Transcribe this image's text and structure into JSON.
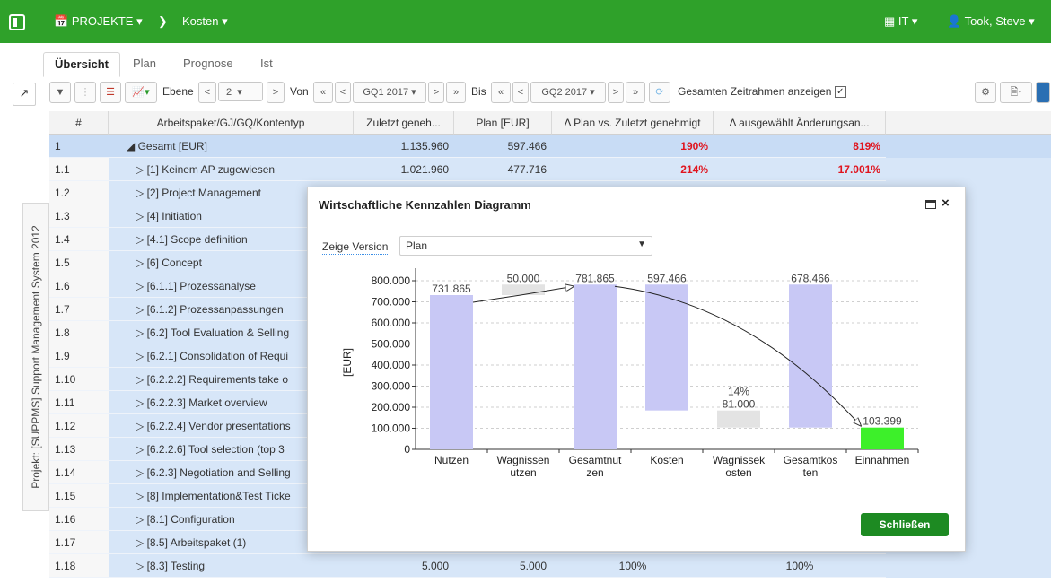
{
  "header": {
    "logo_icon": "panel-icon",
    "projects_label": "PROJEKTE",
    "breadcrumb_item": "Kosten",
    "lang_label": "IT",
    "user_label": "Took, Steve"
  },
  "tabs": [
    "Übersicht",
    "Plan",
    "Prognose",
    "Ist"
  ],
  "toolbar": {
    "ebene_label": "Ebene",
    "ebene_value": "2",
    "von_label": "Von",
    "von_value": "GQ1 2017",
    "bis_label": "Bis",
    "bis_value": "GQ2 2017",
    "full_range_label": "Gesamten Zeitrahmen anzeigen"
  },
  "side_tab": "Projekt: [SUPPMS] Support Management System 2012",
  "table": {
    "headers": [
      "#",
      "Arbeitspaket/GJ/GQ/Kontentyp",
      "Zuletzt geneh...",
      "Plan [EUR]",
      "Δ Plan vs. Zuletzt genehmigt",
      "Δ ausgewählt Änderungsan..."
    ],
    "rows": [
      {
        "num": "1",
        "name": "◢ Gesamt [EUR]",
        "approved": "1.135.960",
        "plan": "597.466",
        "delta": "190%",
        "delta2": "819%"
      },
      {
        "num": "1.1",
        "name": "▷ [1] Keinem AP zugewiesen",
        "approved": "1.021.960",
        "plan": "477.716",
        "delta": "214%",
        "delta2": "17.001%"
      },
      {
        "num": "1.2",
        "name": "▷ [2] Project Management",
        "approved": "",
        "plan": "",
        "delta": "",
        "delta2": ""
      },
      {
        "num": "1.3",
        "name": "▷ [4] Initiation",
        "approved": "",
        "plan": "",
        "delta": "",
        "delta2": ""
      },
      {
        "num": "1.4",
        "name": "▷ [4.1] Scope definition",
        "approved": "",
        "plan": "",
        "delta": "",
        "delta2": ""
      },
      {
        "num": "1.5",
        "name": "▷ [6] Concept",
        "approved": "",
        "plan": "",
        "delta": "",
        "delta2": ""
      },
      {
        "num": "1.6",
        "name": "▷ [6.1.1] Prozessanalyse",
        "approved": "",
        "plan": "",
        "delta": "",
        "delta2": ""
      },
      {
        "num": "1.7",
        "name": "▷ [6.1.2] Prozessanpassungen",
        "approved": "",
        "plan": "",
        "delta": "",
        "delta2": ""
      },
      {
        "num": "1.8",
        "name": "▷ [6.2] Tool Evaluation & Selling",
        "approved": "",
        "plan": "",
        "delta": "",
        "delta2": ""
      },
      {
        "num": "1.9",
        "name": "▷ [6.2.1] Consolidation of Requi",
        "approved": "",
        "plan": "",
        "delta": "",
        "delta2": ""
      },
      {
        "num": "1.10",
        "name": "▷ [6.2.2.2] Requirements take o",
        "approved": "",
        "plan": "",
        "delta": "",
        "delta2": ""
      },
      {
        "num": "1.11",
        "name": "▷ [6.2.2.3] Market overview",
        "approved": "",
        "plan": "",
        "delta": "",
        "delta2": ""
      },
      {
        "num": "1.12",
        "name": "▷ [6.2.2.4] Vendor presentations",
        "approved": "",
        "plan": "",
        "delta": "",
        "delta2": ""
      },
      {
        "num": "1.13",
        "name": "▷ [6.2.2.6] Tool selection (top 3",
        "approved": "",
        "plan": "",
        "delta": "",
        "delta2": ""
      },
      {
        "num": "1.14",
        "name": "▷ [6.2.3] Negotiation and Selling",
        "approved": "",
        "plan": "",
        "delta": "",
        "delta2": ""
      },
      {
        "num": "1.15",
        "name": "▷ [8] Implementation&Test Ticke",
        "approved": "",
        "plan": "",
        "delta": "",
        "delta2": ""
      },
      {
        "num": "1.16",
        "name": "▷ [8.1] Configuration",
        "approved": "",
        "plan": "",
        "delta": "",
        "delta2": ""
      },
      {
        "num": "1.17",
        "name": "▷ [8.5] Arbeitspaket (1)",
        "approved": "",
        "plan": "",
        "delta": "",
        "delta2": ""
      },
      {
        "num": "1.18",
        "name": "▷ [8.3] Testing",
        "approved": "5.000",
        "plan": "5.000",
        "delta": "100%",
        "delta2": "100%"
      }
    ]
  },
  "modal": {
    "title": "Wirtschaftliche Kennzahlen Diagramm",
    "version_label": "Zeige Version",
    "version_value": "Plan",
    "close_button": "Schließen"
  },
  "chart_data": {
    "type": "bar",
    "ylabel": "[EUR]",
    "ylim": [
      0,
      800000
    ],
    "y_ticks": [
      "0",
      "100.000",
      "200.000",
      "300.000",
      "400.000",
      "500.000",
      "600.000",
      "700.000",
      "800.000"
    ],
    "y_tick_values": [
      0,
      100000,
      200000,
      300000,
      400000,
      500000,
      600000,
      700000,
      800000
    ],
    "grid": true,
    "categories": [
      "Nutzen",
      "Wagnissen utzen",
      "Gesamtnut zen",
      "Kosten",
      "Wagnissek osten",
      "Gesamtkos ten",
      "Einnahmen"
    ],
    "category_lines": [
      [
        "Nutzen"
      ],
      [
        "Wagnissen",
        "utzen"
      ],
      [
        "Gesamtnut",
        "zen"
      ],
      [
        "Kosten"
      ],
      [
        "Wagnissek",
        "osten"
      ],
      [
        "Gesamtkos",
        "ten"
      ],
      [
        "Einnahmen"
      ]
    ],
    "bars": [
      {
        "low": 0,
        "high": 731865,
        "label": "731.865",
        "color": "#c8c8f5"
      },
      {
        "low": 731865,
        "high": 781865,
        "label": "50.000",
        "color": "#e3e3e3"
      },
      {
        "low": 0,
        "high": 781865,
        "label": "781.865",
        "color": "#c8c8f5"
      },
      {
        "low": 184399,
        "high": 781865,
        "label": "597.466",
        "color": "#c8c8f5"
      },
      {
        "low": 103399,
        "high": 184399,
        "label": "81.000",
        "color": "#e3e3e3",
        "extra_label": "14%"
      },
      {
        "low": 103399,
        "high": 781865,
        "label": "678.466",
        "color": "#c8c8f5"
      },
      {
        "low": 0,
        "high": 103399,
        "label": "103.399",
        "color": "#3df02a"
      }
    ],
    "arrows": [
      {
        "from_index": 0,
        "from_value": 731865,
        "to_index": 2,
        "to_value": 781865
      },
      {
        "from_index": 2,
        "from_value": 781865,
        "to_index": 6,
        "to_value": 103399
      }
    ]
  }
}
